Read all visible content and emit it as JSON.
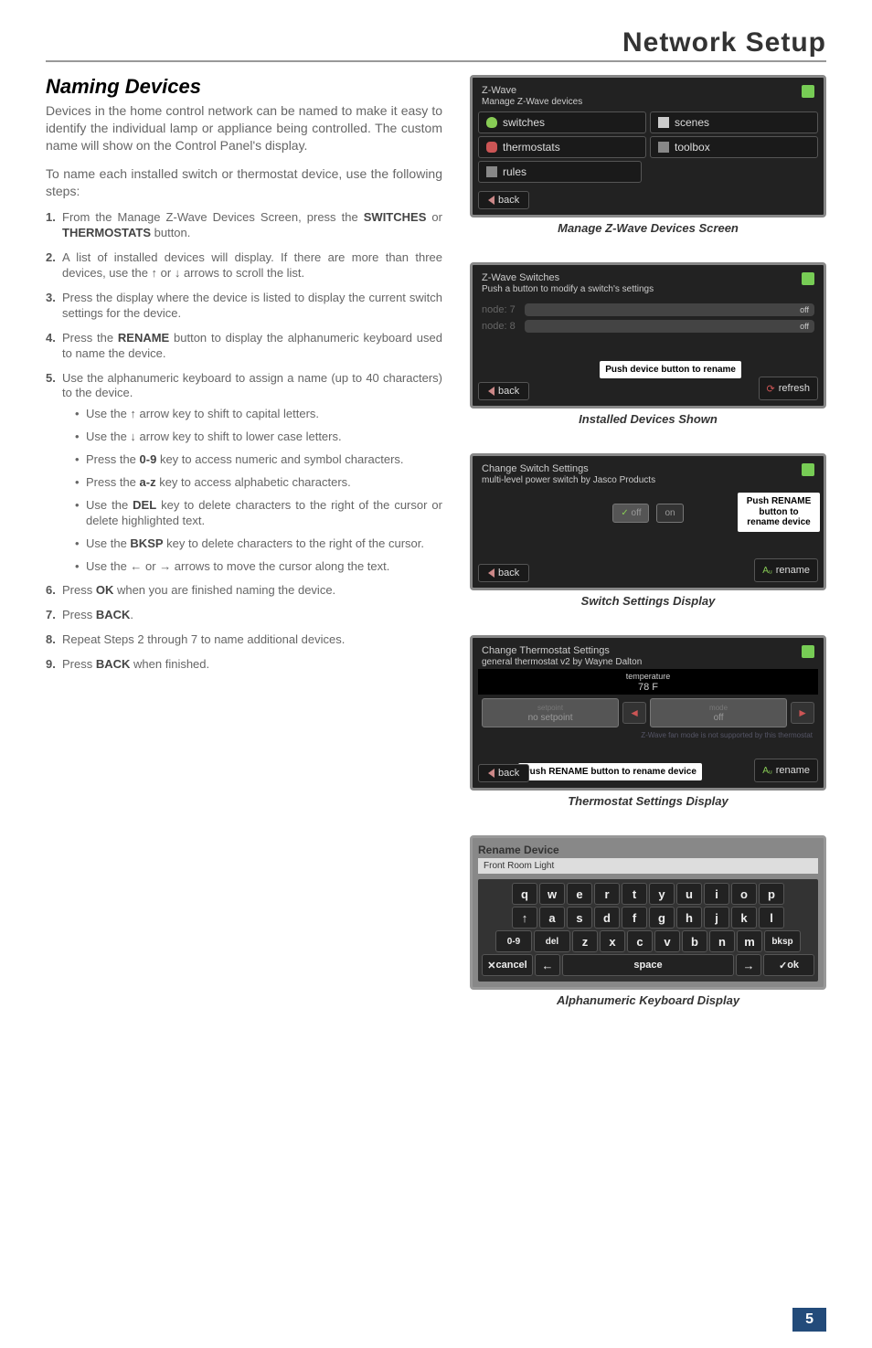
{
  "header": {
    "title": "Network Setup"
  },
  "section": {
    "title": "Naming Devices",
    "intro1": "Devices in the home control network can be named to make it easy to identify the individual lamp or appliance being controlled. The custom name will show on the Control Panel's display.",
    "intro2": "To name each installed switch or thermostat device, use the following steps:"
  },
  "steps": [
    {
      "n": "1.",
      "t": "From the Manage Z-Wave Devices Screen, press the ",
      "b1": "SWITCHES",
      "mid": " or ",
      "b2": "THERMOSTATS",
      "end": " button."
    },
    {
      "n": "2.",
      "t": "A list of installed devices will display. If there are more than three devices, use the ↑ or ↓ arrows to scroll the list."
    },
    {
      "n": "3.",
      "t": "Press the display where the device is listed to display the current switch settings for the device."
    },
    {
      "n": "4.",
      "t": "Press the ",
      "b1": "RENAME",
      "end": " button to display the alphanumeric keyboard used to name the device."
    },
    {
      "n": "5.",
      "t": "Use the alphanumeric keyboard to assign a name (up to 40 characters) to the device."
    },
    {
      "n": "6.",
      "t": "Press ",
      "b1": "OK",
      "end": " when you are finished naming the device."
    },
    {
      "n": "7.",
      "t": "Press ",
      "b1": "BACK",
      "end": "."
    },
    {
      "n": "8.",
      "t": "Repeat Steps 2 through 7 to name additional devices."
    },
    {
      "n": "9.",
      "t": "Press ",
      "b1": "BACK",
      "end": " when finished."
    }
  ],
  "sub": [
    {
      "t": "Use the ↑ arrow key to shift to capital letters."
    },
    {
      "t": "Use the ↓ arrow key to shift to lower case letters."
    },
    {
      "t": "Press the ",
      "b": "0-9",
      "end": " key to access numeric and symbol characters."
    },
    {
      "t": "Press the ",
      "b": "a-z",
      "end": " key to access alphabetic characters."
    },
    {
      "t": "Use the ",
      "b": "DEL",
      "end": " key to delete characters to the right of the cursor or delete highlighted text."
    },
    {
      "t": "Use the ",
      "b": "BKSP",
      "end": " key to delete characters to the right of the cursor."
    },
    {
      "t": "Use the ← or → arrows to move the cursor along the text."
    }
  ],
  "fig1": {
    "header1": "Z-Wave",
    "header2": "Manage Z-Wave devices",
    "switches": "switches",
    "scenes": "scenes",
    "thermostats": "thermostats",
    "toolbox": "toolbox",
    "rules": "rules",
    "back": "back",
    "caption": "Manage Z-Wave Devices Screen"
  },
  "fig2": {
    "header1": "Z-Wave Switches",
    "header2": "Push a button to modify a switch's settings",
    "node7": "node: 7",
    "node8": "node: 8",
    "off": "off",
    "callout": "Push device button to rename",
    "back": "back",
    "refresh": "refresh",
    "caption": "Installed Devices Shown"
  },
  "fig3": {
    "header1": "Change Switch Settings",
    "header2": "multi-level power switch by Jasco Products",
    "off": "off",
    "on": "on",
    "callout": "Push RENAME button to rename device",
    "back": "back",
    "rename": "rename",
    "caption": "Switch Settings Display"
  },
  "fig4": {
    "header1": "Change Thermostat Settings",
    "header2": "general thermostat v2 by Wayne Dalton",
    "templabel": "temperature",
    "temp": "78 F",
    "setpointlabel": "setpoint",
    "nosetpoint": "no setpoint",
    "mode": "mode",
    "off": "off",
    "fanmsg": "Z-Wave fan mode is not supported by this thermostat",
    "callout": "Push RENAME button to rename device",
    "back": "back",
    "rename": "rename",
    "caption": "Thermostat Settings Display"
  },
  "fig5": {
    "header": "Rename Device",
    "input": "Front Room Light",
    "row1": [
      "q",
      "w",
      "e",
      "r",
      "t",
      "y",
      "u",
      "i",
      "o",
      "p"
    ],
    "row2_prefix": "↑",
    "row2": [
      "a",
      "s",
      "d",
      "f",
      "g",
      "h",
      "j",
      "k",
      "l"
    ],
    "row3_prefix": "0-9",
    "row3_del": "del",
    "row3": [
      "z",
      "x",
      "c",
      "v",
      "b",
      "n",
      "m"
    ],
    "row3_bksp": "bksp",
    "cancel": "cancel",
    "left": "←",
    "space": "space",
    "right": "→",
    "ok": "ok",
    "caption": "Alphanumeric Keyboard Display"
  },
  "pagenum": "5"
}
